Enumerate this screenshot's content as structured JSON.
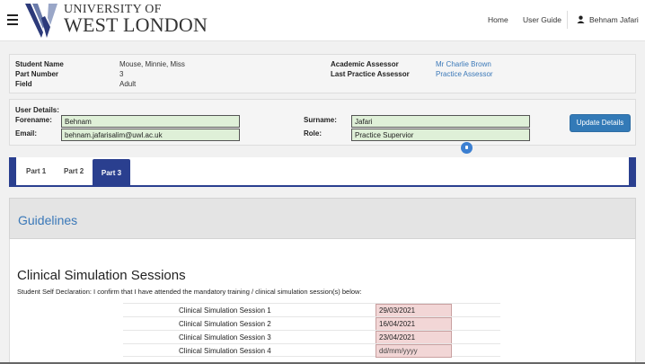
{
  "header": {
    "logo_line1": "UNIVERSITY OF",
    "logo_line2": "WEST LONDON",
    "nav": {
      "home": "Home",
      "user_guide": "User Guide",
      "user_name": "Behnam Jafari"
    }
  },
  "student": {
    "name_label": "Student Name",
    "name_value": "Mouse, Minnie, Miss",
    "part_label": "Part Number",
    "part_value": "3",
    "field_label": "Field",
    "field_value": "Adult",
    "assessor_label": "Academic Assessor",
    "assessor_value": "Mr Charlie Brown",
    "practice_label": "Last Practice Assessor",
    "practice_value": "Practice Assessor"
  },
  "user_details": {
    "heading": "User Details:",
    "forename_label": "Forename:",
    "forename_value": "Behnam",
    "email_label": "Email:",
    "email_value": "behnam.jafarisalim@uwl.ac.uk",
    "surname_label": "Surname:",
    "surname_value": "Jafari",
    "role_label": "Role:",
    "role_value": "Practice Supervior",
    "update_button": "Update Details"
  },
  "tabs": {
    "part1": "Part 1",
    "part2": "Part 2",
    "part3": "Part 3",
    "active": "Part 3"
  },
  "guidelines": {
    "title": "Guidelines"
  },
  "simulation": {
    "title": "Clinical Simulation Sessions",
    "declaration": "Student Self Declaration: I confirm that I have attended the mandatory training / clinical simulation session(s) below:",
    "sessions": [
      {
        "label": "Clinical Simulation Session 1",
        "date": "29/03/2021"
      },
      {
        "label": "Clinical Simulation Session 2",
        "date": "16/04/2021"
      },
      {
        "label": "Clinical Simulation Session 3",
        "date": "23/04/2021"
      },
      {
        "label": "Clinical Simulation Session 4",
        "date": "dd/mm/yyyy"
      }
    ]
  },
  "colors": {
    "brand": "#2a3f8f",
    "link": "#3a78b8",
    "button": "#337ab7",
    "field_ok": "#dff0d8",
    "field_date": "#f2d6d6"
  }
}
